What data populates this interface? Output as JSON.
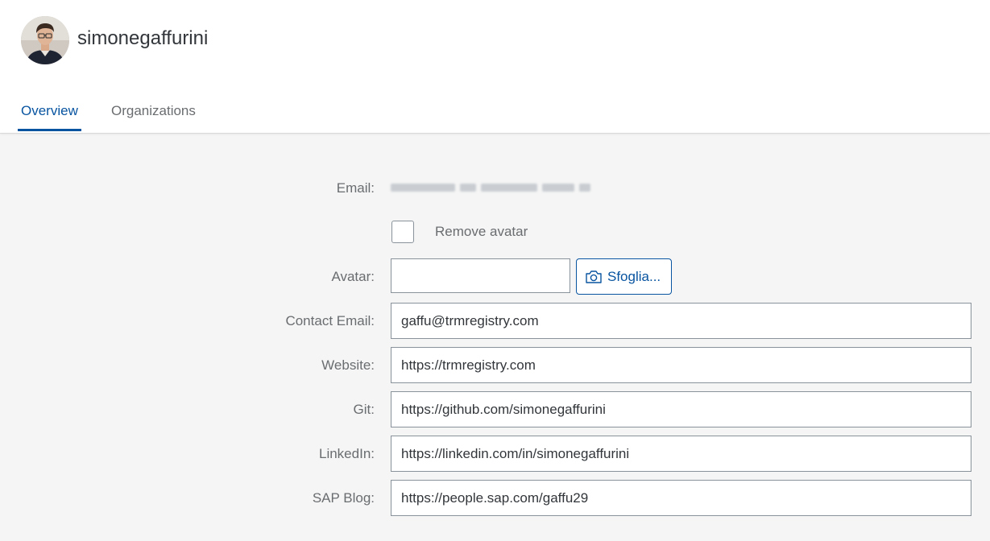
{
  "profile": {
    "username": "simonegaffurini",
    "avatar_alt": "user avatar"
  },
  "tabs": [
    {
      "label": "Overview",
      "selected": true
    },
    {
      "label": "Organizations",
      "selected": false
    }
  ],
  "form": {
    "email_label": "Email:",
    "email_value": "redacted (blurred)",
    "remove_avatar_label": "Remove avatar",
    "remove_avatar_checked": false,
    "avatar_label": "Avatar:",
    "avatar_file_value": "",
    "browse_label": "Sfoglia...",
    "contact_email_label": "Contact Email:",
    "contact_email_value": "gaffu@trmregistry.com",
    "website_label": "Website:",
    "website_value": "https://trmregistry.com",
    "git_label": "Git:",
    "git_value": "https://github.com/simonegaffurini",
    "linkedin_label": "LinkedIn:",
    "linkedin_value": "https://linkedin.com/in/simonegaffurini",
    "sapblog_label": "SAP Blog:",
    "sapblog_value": "https://people.sap.com/gaffu29"
  },
  "icons": {
    "browse": "camera-icon"
  },
  "colors": {
    "accent": "#0854a0",
    "label": "#6a6d70",
    "background": "#f5f5f5",
    "field_border": "#89919a"
  }
}
